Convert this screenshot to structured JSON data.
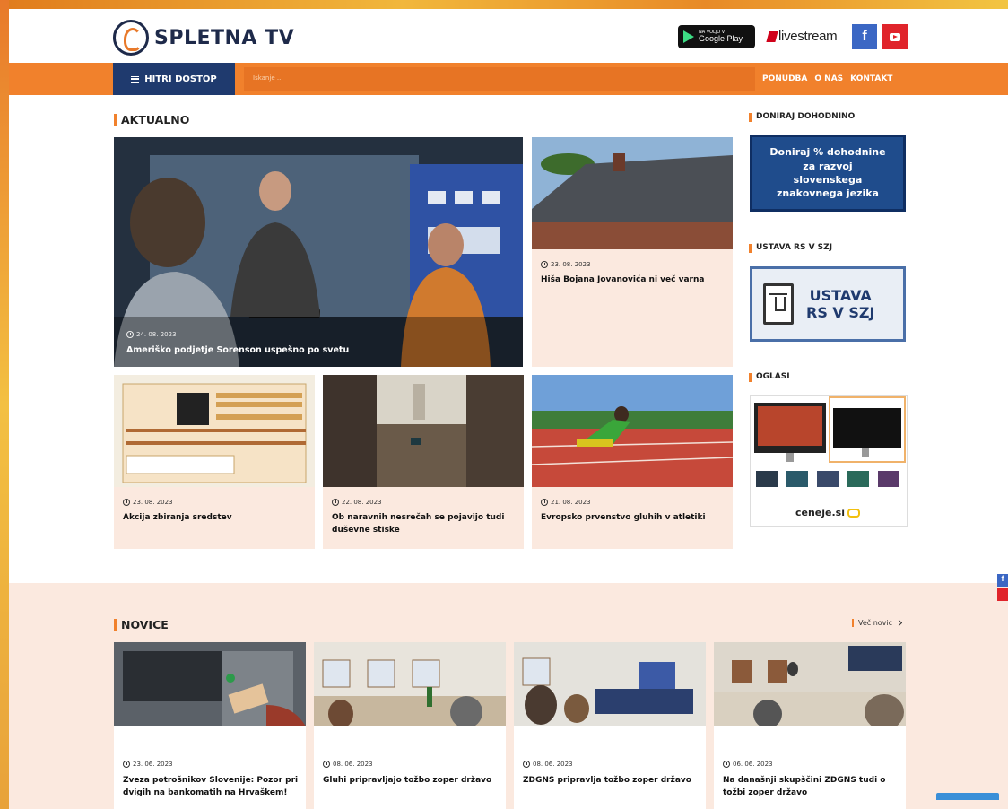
{
  "header": {
    "logo_text": "SPLETNA TV",
    "gplay_small": "NA VOLJO V",
    "gplay_big": "Google Play",
    "livestream": "livestream",
    "fb_glyph": "f"
  },
  "nav": {
    "hitri": "HITRI DOSTOP",
    "search_placeholder": "Iskanje ...",
    "links": [
      "PONUDBA",
      "O NAS",
      "KONTAKT"
    ]
  },
  "aktualno": {
    "title": "AKTUALNO",
    "feature": {
      "date": "24. 08. 2023",
      "title": "Ameriško podjetje Sorenson uspešno po svetu"
    },
    "cards": [
      {
        "date": "23. 08. 2023",
        "title": "Hiša Bojana Jovanovića ni več varna"
      },
      {
        "date": "23. 08. 2023",
        "title": "Akcija zbiranja sredstev"
      },
      {
        "date": "22. 08. 2023",
        "title": "Ob naravnih nesrečah se pojavijo tudi duševne stiske"
      },
      {
        "date": "21. 08. 2023",
        "title": "Evropsko prvenstvo gluhih v atletiki"
      }
    ]
  },
  "sidebar": {
    "donate_title": "DONIRAJ DOHODNINO",
    "donate_text": "Doniraj % dohodnine za razvoj slovenskega znakovnega jezika",
    "ustava_title": "USTAVA RS V SZJ",
    "ustava_line1": "USTAVA",
    "ustava_line2": "RS V SZJ",
    "oglasi_title": "OGLASI",
    "ceneje": "ceneje.si"
  },
  "novice": {
    "title": "NOVICE",
    "more": "Več novic",
    "items": [
      {
        "date": "23. 06. 2023",
        "title": "Zveza potrošnikov Slovenije: Pozor pri dvigih na bankomatih na Hrvaškem!"
      },
      {
        "date": "08. 06. 2023",
        "title": "Gluhi pripravljajo tožbo zoper državo"
      },
      {
        "date": "08. 06. 2023",
        "title": "ZDGNS pripravlja tožbo zoper državo"
      },
      {
        "date": "06. 06. 2023",
        "title": "Na današnji skupščini ZDGNS tudi o tožbi zoper državo"
      }
    ]
  },
  "colors": {
    "accent": "#f1812c",
    "navy": "#1f3a6e",
    "card_bg": "#fbe9df"
  }
}
